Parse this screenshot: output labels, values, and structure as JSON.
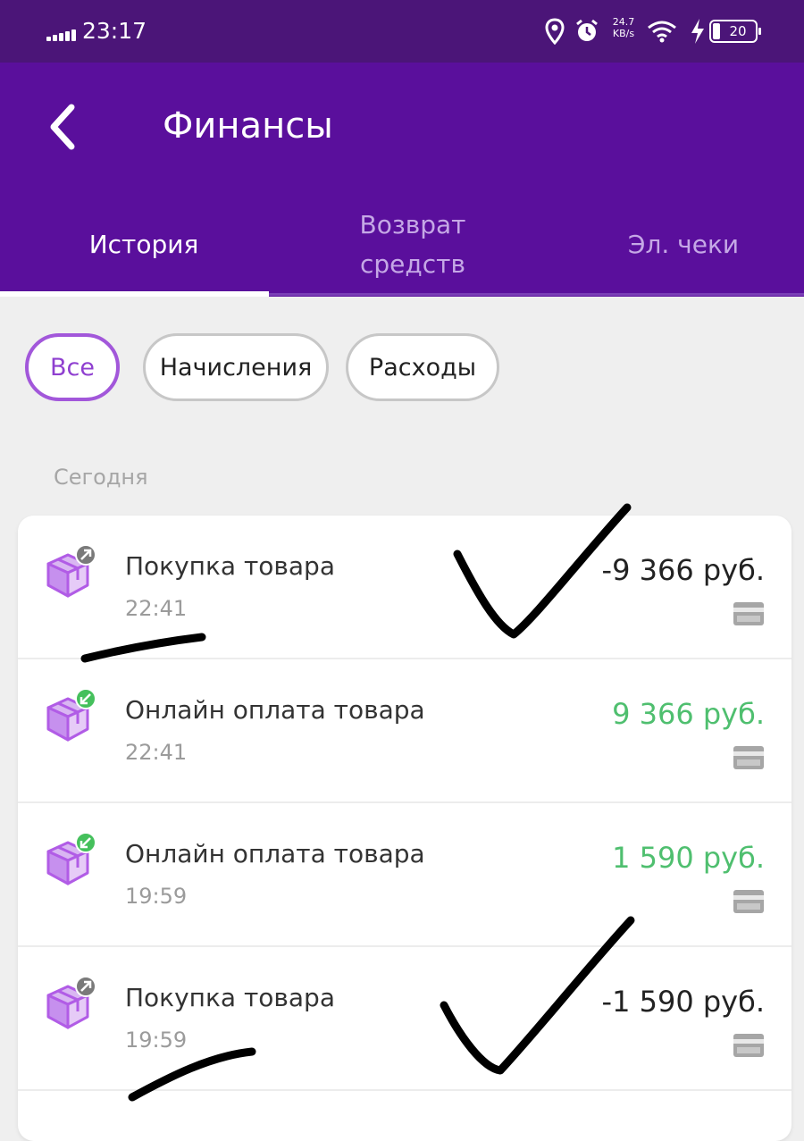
{
  "status_bar": {
    "time": "23:17",
    "speed_top": "24.7",
    "speed_unit": "KB/s",
    "battery": "20"
  },
  "header": {
    "title": "Финансы",
    "tabs": [
      {
        "label": "История",
        "active": true
      },
      {
        "label": "Возврат средств",
        "active": false
      },
      {
        "label": "Эл. чеки",
        "active": false
      }
    ]
  },
  "filters": {
    "all": "Все",
    "income": "Начисления",
    "expenses": "Расходы",
    "selected": "Все"
  },
  "section_label": "Сегодня",
  "transactions": [
    {
      "title": "Покупка товара",
      "time": "22:41",
      "amount": "-9 366 руб.",
      "direction": "outgoing"
    },
    {
      "title": "Онлайн оплата товара",
      "time": "22:41",
      "amount": "9 366 руб.",
      "direction": "incoming"
    },
    {
      "title": "Онлайн оплата товара",
      "time": "19:59",
      "amount": "1 590 руб.",
      "direction": "incoming"
    },
    {
      "title": "Покупка товара",
      "time": "19:59",
      "amount": "-1 590 руб.",
      "direction": "outgoing"
    }
  ],
  "colors": {
    "header": "#5a0f9c",
    "status_bar": "#4b1578",
    "accent": "#a257da",
    "positive": "#4fbf6f"
  },
  "icons": [
    "package-icon",
    "outgoing-arrow-badge-icon",
    "incoming-arrow-badge-icon",
    "bank-card-icon",
    "back-arrow-icon"
  ]
}
